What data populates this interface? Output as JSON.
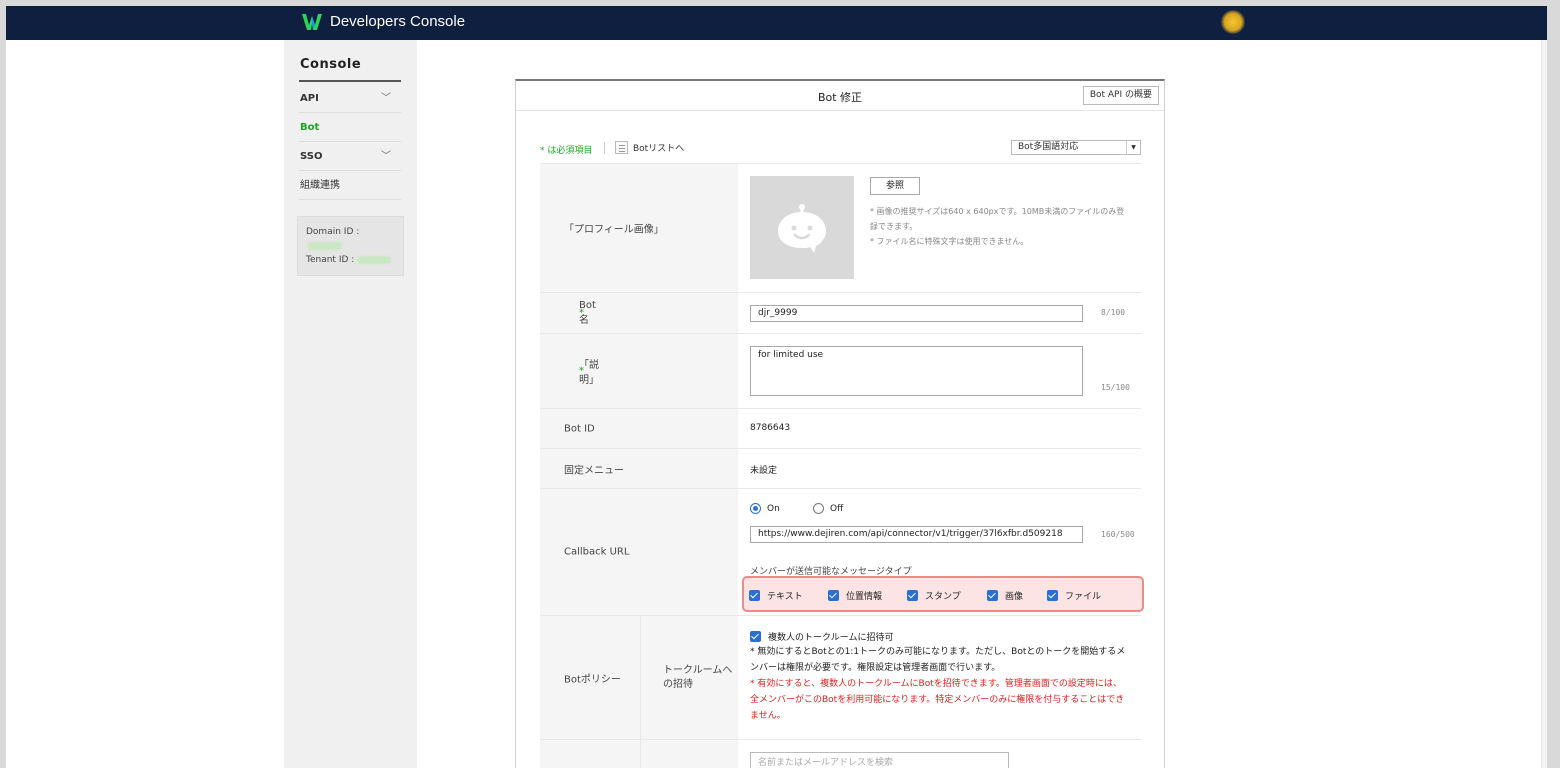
{
  "app": {
    "title": "Developers Console"
  },
  "sidebar": {
    "title": "Console",
    "items": [
      {
        "label": "API",
        "has_chevron": true
      },
      {
        "label": "Bot",
        "active": true
      },
      {
        "label": "SSO",
        "has_chevron": true
      },
      {
        "label": "組織連携"
      }
    ],
    "domain_label": "Domain ID :",
    "tenant_label": "Tenant ID :"
  },
  "panel": {
    "title": "Bot 修正",
    "api_button": "Bot API の概要",
    "required_note": "* は必須項目",
    "list_link": "Botリストへ",
    "lang_select": "Bot多国語対応"
  },
  "form": {
    "profile": {
      "label": "「プロフィール画像」",
      "browse": "参照",
      "note1": "* 画像の推奨サイズは640 x 640pxです。10MB未満のファイルのみ登録できます。",
      "note2": "* ファイル名に特殊文字は使用できません。"
    },
    "bot_name": {
      "label": "Bot名",
      "value": "djr_9999",
      "counter": "8/100"
    },
    "description": {
      "label": "「説明」",
      "value": "for limited use",
      "counter": "15/100"
    },
    "bot_id": {
      "label": "Bot ID",
      "value": "8786643"
    },
    "fixed_menu": {
      "label": "固定メニュー",
      "value": "未設定"
    },
    "callback": {
      "label": "Callback URL",
      "on": "On",
      "off": "Off",
      "url": "https://www.dejiren.com/api/connector/v1/trigger/37l6xfbr.d509218",
      "counter": "160/500",
      "msg_type_label": "メンバーが送信可能なメッセージタイプ",
      "types": [
        "テキスト",
        "位置情報",
        "スタンプ",
        "画像",
        "ファイル"
      ]
    },
    "policy": {
      "label": "Botポリシー",
      "sub_label": "トークルームへの招待",
      "checkbox": "複数人のトークルームに招待可",
      "note": "* 無効にするとBotとの1:1トークのみ可能になります。ただし、Botとのトークを開始するメンバーは権限が必要です。権限設定は管理者画面で行います。",
      "warning": "* 有効にすると、複数人のトークルームにBotを招待できます。管理者画面での設定時には、全メンバーがこのBotを利用可能になります。特定メンバーのみに権限を付与することはできません。"
    },
    "search": {
      "placeholder": "名前またはメールアドレスを検索"
    }
  },
  "colors": {
    "topbar": "#0f1f40",
    "accent_green": "#19a823",
    "highlight_border": "#ee8a8a",
    "warning_red": "#e02020"
  }
}
